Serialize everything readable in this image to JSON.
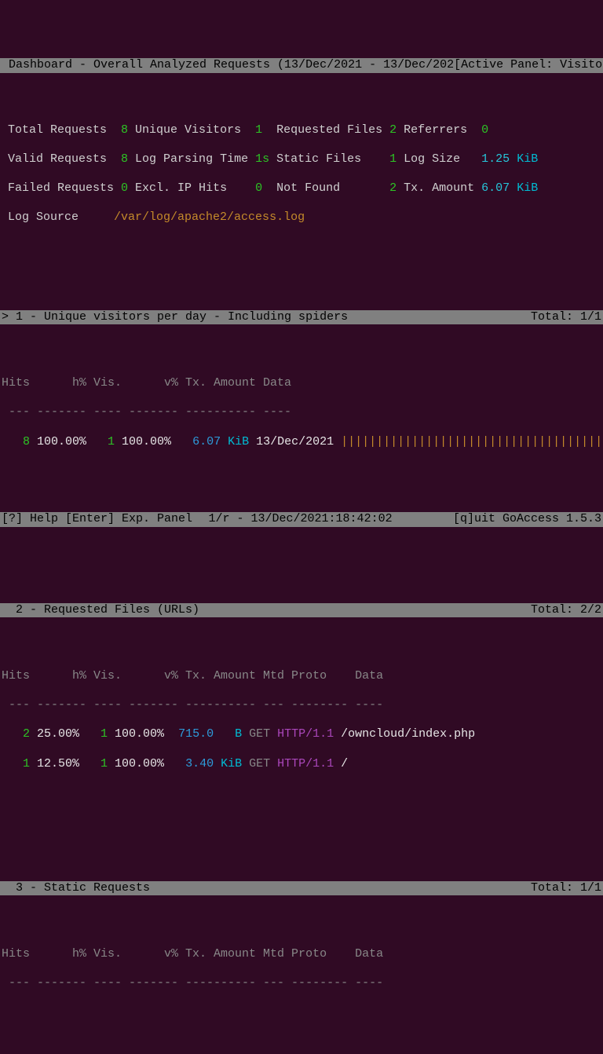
{
  "titlebar": {
    "title": " Dashboard - Overall Analyzed Requests (13/Dec/2021 - 13/Dec/202",
    "active": "[Active Panel: Visitors]"
  },
  "stats": {
    "r1c1": "Total Requests ",
    "r1v1": " 8",
    "r1c2": " Unique Visitors ",
    "r1v2": " 1",
    "r1c3": "  Requested Files ",
    "r1v3": "2",
    "r1c4": " Referrers  ",
    "r1v4": "0",
    "r2c1": "Valid Requests ",
    "r2v1": " 8",
    "r2c2": " Log Parsing Time ",
    "r2v2": "1s",
    "r2c3": " Static Files    ",
    "r2v3": "1",
    "r2c4": " Log Size   ",
    "r2v4a": "1.25",
    "r2v4b": " KiB",
    "r3c1": "Failed Requests",
    "r3v1": " 0",
    "r3c2": " Excl. IP Hits   ",
    "r3v2": " 0",
    "r3c3": "  Not Found       ",
    "r3v3": "2",
    "r3c4": " Tx. Amount ",
    "r3v4a": "6.07",
    "r3v4b": " KiB",
    "r4c1": "Log Source     ",
    "r4v1": "/var/log/apache2/access.log"
  },
  "panel1": {
    "header": "> 1 - Unique visitors per day - Including spiders",
    "total": "Total: 1/1",
    "cols": "Hits      h% Vis.      v% Tx. Amount Data",
    "dash": " --- ------- ---- ------- ---------- ----",
    "row": {
      "hits": "   8",
      "hp": " 100.00%",
      "vis": "   1",
      "vp": " 100.00%",
      "txa": "   6.07",
      "txu": " KiB",
      "date": " 13/Dec/2021 ",
      "bars": "|||||||||||||||||||||||||||||||||||||||||||"
    }
  },
  "panel2": {
    "header": "  2 - Requested Files (URLs)",
    "total": "Total: 2/2",
    "cols": "Hits      h% Vis.      v% Tx. Amount Mtd Proto    Data",
    "dash": " --- ------- ---- ------- ---------- --- -------- ----",
    "rows": [
      {
        "hits": "   2",
        "hp": " 25.00%",
        "vis": "   1",
        "vp": " 100.00%",
        "txa": "  715.0 ",
        "txu": "  B",
        "mtd": " GET ",
        "proto": "HTTP/1.1 ",
        "data": "/owncloud/index.php"
      },
      {
        "hits": "   1",
        "hp": " 12.50%",
        "vis": "   1",
        "vp": " 100.00%",
        "txa": "   3.40",
        "txu": " KiB",
        "mtd": " GET ",
        "proto": "HTTP/1.1 ",
        "data": "/"
      }
    ]
  },
  "panel3": {
    "header": "  3 - Static Requests",
    "total": "Total: 1/1",
    "cols": "Hits      h% Vis.      v% Tx. Amount Mtd Proto    Data",
    "dash": " --- ------- ---- ------- ---------- --- -------- ----"
  },
  "status": {
    "left": "[?] Help [Enter] Exp. Panel",
    "mid": "1/r - 13/Dec/2021:18:42:02",
    "right": "[q]uit GoAccess 1.5.3"
  }
}
